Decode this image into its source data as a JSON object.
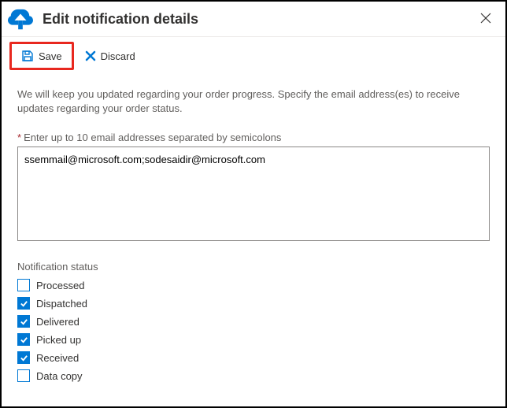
{
  "header": {
    "title": "Edit notification details"
  },
  "toolbar": {
    "save_label": "Save",
    "discard_label": "Discard"
  },
  "description": "We will keep you updated regarding your order progress. Specify the email address(es) to receive updates regarding your order status.",
  "email_field": {
    "label": "Enter up to 10 email addresses separated by semicolons",
    "value": "ssemmail@microsoft.com;sodesaidir@microsoft.com"
  },
  "notification_status": {
    "label": "Notification status",
    "items": [
      {
        "label": "Processed",
        "checked": false
      },
      {
        "label": "Dispatched",
        "checked": true
      },
      {
        "label": "Delivered",
        "checked": true
      },
      {
        "label": "Picked up",
        "checked": true
      },
      {
        "label": "Received",
        "checked": true
      },
      {
        "label": "Data copy",
        "checked": false
      }
    ]
  },
  "colors": {
    "accent": "#0078d4",
    "highlight": "#e8281f"
  }
}
